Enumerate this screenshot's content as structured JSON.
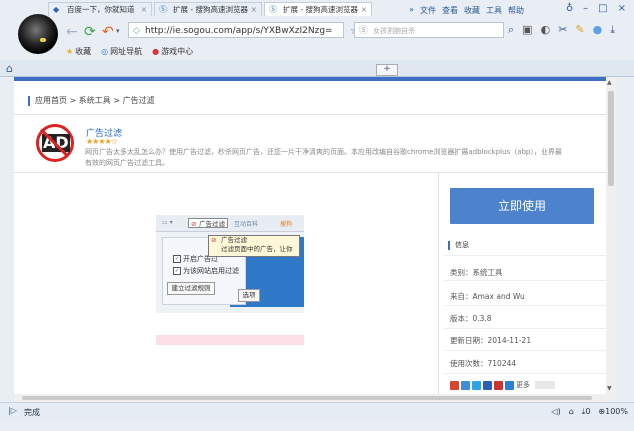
{
  "browser": {
    "menu": [
      "文件",
      "查看",
      "收藏",
      "工具",
      "帮助"
    ],
    "window_controls": [
      "minimize-icon",
      "maximize-icon",
      "close-icon"
    ],
    "address": "http://ie.sogou.com/app/s/YXBwXzI2Nzg=",
    "search_placeholder": "女孩割腕自杀",
    "bookmarks": [
      {
        "icon": "star-icon",
        "label": "收藏"
      },
      {
        "icon": "globe-icon",
        "label": "网址导航"
      },
      {
        "icon": "game-icon",
        "label": "游戏中心"
      }
    ],
    "tabs": [
      {
        "label": "百度一下，你就知道",
        "active": false
      },
      {
        "label": "扩展 - 搜狗高速浏览器",
        "active": false
      },
      {
        "label": "扩展 - 搜狗高速浏览器",
        "active": true
      }
    ],
    "new_tab": "+"
  },
  "page": {
    "breadcrumb": "应用首页 > 系统工具 > 广告过滤",
    "extension": {
      "logo_text": "AD",
      "name": "广告过滤",
      "rating": "★★★★☆",
      "description": "网页广告太多太乱怎么办？使用广告过滤，秒杀网页广告，还您一片干净清爽的页面。本应用改编自谷歌chrome浏览器扩展adblockplus（abp），业界最有效的网页广告过滤工具。"
    },
    "screenshot": {
      "toolbar_button": "广告过滤",
      "toolbar_other": "互动百科",
      "toolbar_other2": "搜狗",
      "tooltip_line1": "广告过滤",
      "tooltip_line2": "过滤页面中的广告，让你",
      "check1": "开启广告过",
      "check2": "为该网站启用过滤",
      "rule_button": "建立过滤规则",
      "option_button": "选项"
    },
    "use_button": "立即使用",
    "info_title": "信息",
    "info": [
      "类别：系统工具",
      "来自：Amax and Wu",
      "版本：0.3.8",
      "更新日期：2014-11-21",
      "使用次数：710244"
    ],
    "share_label": "更多",
    "share_colors": [
      "#d9452b",
      "#3b8fd9",
      "#2ea3e8",
      "#e05a2a",
      "#c33",
      "#2a7fd4"
    ]
  },
  "status": {
    "left": "完成",
    "download_count": "0",
    "zoom": "100%"
  }
}
